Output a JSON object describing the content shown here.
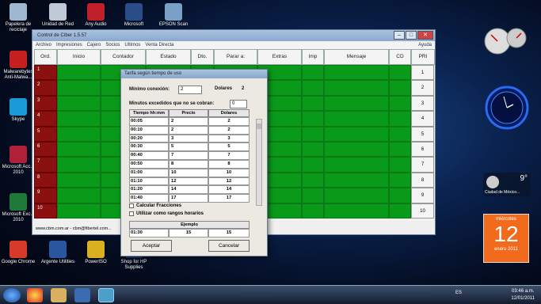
{
  "desktop_icons": [
    {
      "label": "Papelera de reciclaje",
      "color": "#9fb7d0"
    },
    {
      "label": "Unidad de Red",
      "color": "#bfc9d6"
    },
    {
      "label": "Any Audio",
      "color": "#c0202a"
    },
    {
      "label": "Microsoft",
      "color": "#2a4d8a"
    },
    {
      "label": "EPSON Scan",
      "color": "#7aa0c8"
    },
    {
      "label": "Malwarebytes Anti-Malwa...",
      "color": "#c42020"
    },
    {
      "label": "Skype",
      "color": "#1a9ad6"
    },
    {
      "label": "Microsoft Acc... 2010",
      "color": "#b0203a"
    },
    {
      "label": "Microsoft Exc... 2010",
      "color": "#1f7a3a"
    },
    {
      "label": "Google Chrome",
      "color": "#d83a2a"
    },
    {
      "label": "Argente Utilities",
      "color": "#2a56a0"
    },
    {
      "label": "PowerISO",
      "color": "#d8b020"
    },
    {
      "label": "Shop for HP Supplies",
      "color": "#1a3a7a"
    }
  ],
  "main_window": {
    "title": "Control de Cíber 1.5.57",
    "menu": [
      "Archivo",
      "Impresiones",
      "Cajero",
      "Socios",
      "Ultimos",
      "Venta Directa"
    ],
    "help": "Ayuda",
    "columns": [
      "Ord.",
      "Inicio",
      "Contador",
      "Estado",
      "Dto.",
      "Parar a:",
      "Extras",
      "Imp",
      "Mensaje",
      "CD"
    ],
    "pri_header": "PRI",
    "row_numbers": [
      "1",
      "2",
      "3",
      "4",
      "5",
      "6",
      "7",
      "8",
      "9",
      "10"
    ],
    "pri_values": [
      "1",
      "2",
      "3",
      "4",
      "5",
      "6",
      "7",
      "8",
      "9",
      "10"
    ],
    "status_text": "www.cbm.com.ar - cbm@fibertel.com..."
  },
  "dialog": {
    "title": "Tarifa según tiempo de uso",
    "min_conexion_label": "Mínimo conexión:",
    "min_conexion_value": "2",
    "dolares_label": "Dolares",
    "dolares_value": "2",
    "minutos_label": "Minutos excedidos que no se cobran:",
    "minutos_value": "0",
    "table_headers": [
      "Tiempo hh:mm",
      "Precio",
      "Dolares"
    ],
    "rows": [
      {
        "t": "00:05",
        "p": "2",
        "d": "2"
      },
      {
        "t": "00:10",
        "p": "2",
        "d": "2"
      },
      {
        "t": "00:20",
        "t2": "",
        "p": "3",
        "d": "3"
      },
      {
        "t": "00:30",
        "p": "5",
        "d": "5"
      },
      {
        "t": "00:40",
        "p": "7",
        "d": "7"
      },
      {
        "t": "00:50",
        "p": "8",
        "d": "8"
      },
      {
        "t": "01:00",
        "p": "10",
        "d": "10"
      },
      {
        "t": "01:10",
        "p": "12",
        "d": "12"
      },
      {
        "t": "01:20",
        "p": "14",
        "d": "14"
      },
      {
        "t": "01:40",
        "p": "17",
        "d": "17"
      }
    ],
    "calc_fracciones": "Calcular Fracciones",
    "rangos_horarios": "Utilizar como rangos horarios",
    "ejemplo_label": "Ejemplo",
    "ejemplo_values": [
      "01:30",
      "15",
      "15"
    ],
    "accept": "Aceptar",
    "cancel": "Cancelar"
  },
  "gadgets": {
    "weather_temp": "9°",
    "weather_city": "Ciudad de México...",
    "calendar_day_name": "miércoles",
    "calendar_day": "12",
    "calendar_month_year": "enero 2011"
  },
  "taskbar": {
    "lang": "ES",
    "time": "03:46 a.m.",
    "date": "12/01/2011"
  }
}
